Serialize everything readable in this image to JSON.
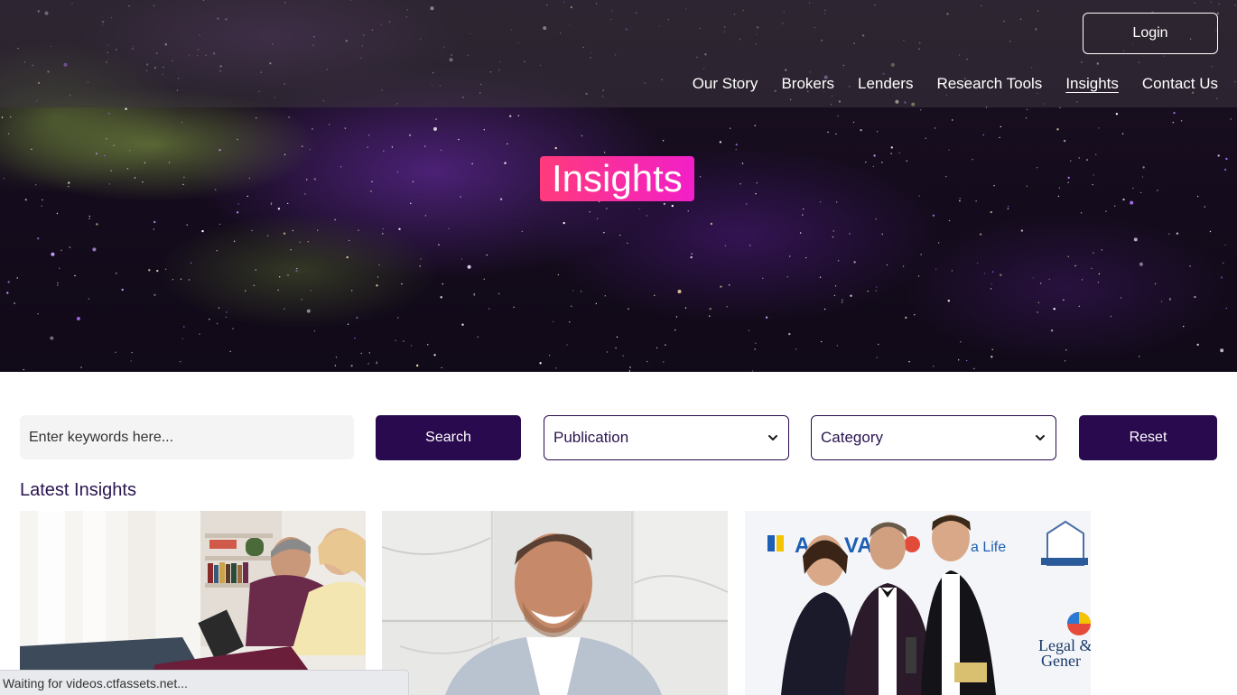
{
  "header": {
    "login_label": "Login",
    "nav": [
      {
        "label": "Our Story",
        "active": false
      },
      {
        "label": "Brokers",
        "active": false
      },
      {
        "label": "Lenders",
        "active": false
      },
      {
        "label": "Research Tools",
        "active": false
      },
      {
        "label": "Insights",
        "active": true
      },
      {
        "label": "Contact Us",
        "active": false
      }
    ]
  },
  "hero": {
    "title": "Insights"
  },
  "filters": {
    "search_placeholder": "Enter keywords here...",
    "search_label": "Search",
    "publication_label": "Publication",
    "category_label": "Category",
    "reset_label": "Reset"
  },
  "section": {
    "title": "Latest Insights"
  },
  "cards": [
    {
      "image": "older-couple-reading-tablet-photo"
    },
    {
      "image": "smiling-man-marble-wall-photo"
    },
    {
      "image": "awards-event-three-people-photo",
      "logos_text": [
        "A",
        "VA",
        "a Life",
        "Legal &",
        "Gener"
      ]
    }
  ],
  "status_bar": {
    "text": "Waiting for videos.ctfassets.net..."
  },
  "colors": {
    "accent_dark": "#2a0a4f",
    "title_gradient_start": "#ff3a7c",
    "title_gradient_end": "#f21fc8"
  }
}
